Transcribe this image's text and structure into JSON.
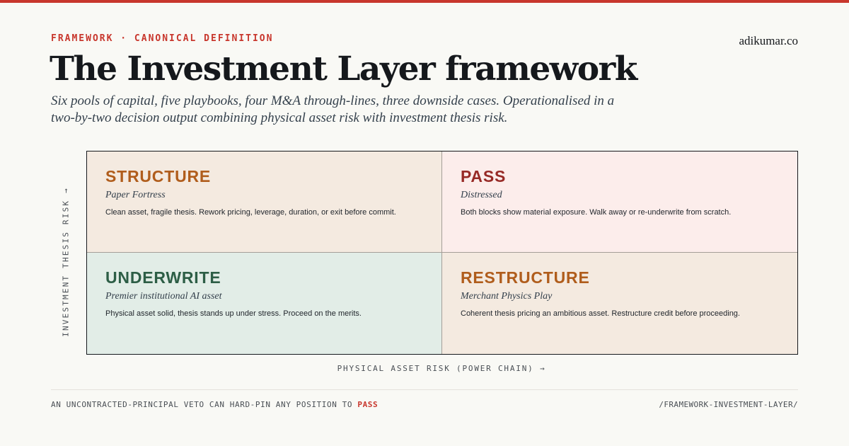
{
  "header": {
    "eyebrow": "FRAMEWORK · CANONICAL DEFINITION",
    "site": "adikumar.co",
    "title": "The Investment Layer framework",
    "subtitle": "Six pools of capital, five playbooks, four M&A through-lines, three downside cases. Operationalised in a two-by-two decision output combining physical asset risk with investment thesis risk."
  },
  "matrix": {
    "y_axis_label": "INVESTMENT THESIS RISK →",
    "x_axis_label": "PHYSICAL ASSET RISK (POWER CHAIN) →",
    "cells": [
      {
        "title": "STRUCTURE",
        "subtitle": "Paper Fortress",
        "description": "Clean asset, fragile thesis. Rework pricing, leverage, duration, or exit before commit."
      },
      {
        "title": "PASS",
        "subtitle": "Distressed",
        "description": "Both blocks show material exposure. Walk away or re-underwrite from scratch."
      },
      {
        "title": "UNDERWRITE",
        "subtitle": "Premier institutional AI asset",
        "description": "Physical asset solid, thesis stands up under stress. Proceed on the merits."
      },
      {
        "title": "RESTRUCTURE",
        "subtitle": "Merchant Physics Play",
        "description": "Coherent thesis pricing an ambitious asset. Restructure credit before proceeding."
      }
    ]
  },
  "footer": {
    "note": "AN UNCONTRACTED-PRINCIPAL VETO CAN HARD-PIN ANY POSITION TO ",
    "note_accent": "PASS",
    "path": "/FRAMEWORK-INVESTMENT-LAYER/"
  },
  "colors": {
    "accent": "#c8372d",
    "structure": "#b05d1c",
    "pass": "#972a26",
    "underwrite": "#2d5e46",
    "restructure": "#b05d1c"
  }
}
